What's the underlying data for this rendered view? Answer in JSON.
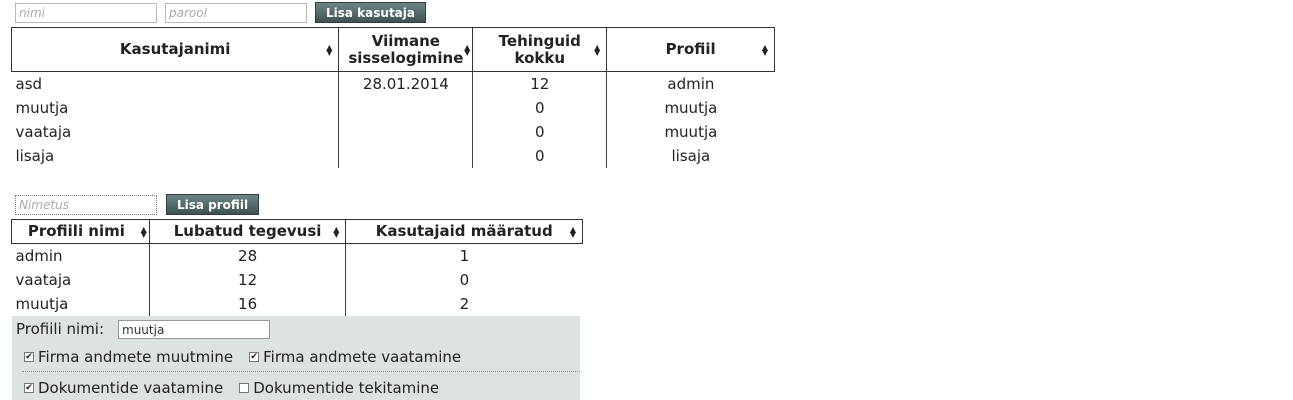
{
  "user_form": {
    "username_placeholder": "nimi",
    "password_placeholder": "parool",
    "add_button": "Lisa kasutaja"
  },
  "users_table": {
    "headers": {
      "username": "Kasutajanimi",
      "last_login_line1": "Viimane",
      "last_login_line2": "sisselogimine",
      "transactions_line1": "Tehinguid",
      "transactions_line2": "kokku",
      "profile": "Profiil"
    },
    "rows": [
      {
        "username": "asd",
        "last_login": "28.01.2014",
        "transactions": "12",
        "profile": "admin"
      },
      {
        "username": "muutja",
        "last_login": "",
        "transactions": "0",
        "profile": "muutja"
      },
      {
        "username": "vaataja",
        "last_login": "",
        "transactions": "0",
        "profile": "muutja"
      },
      {
        "username": "lisaja",
        "last_login": "",
        "transactions": "0",
        "profile": "lisaja"
      }
    ]
  },
  "profile_form": {
    "name_placeholder": "Nimetus",
    "add_button": "Lisa profiil"
  },
  "profiles_table": {
    "headers": {
      "name": "Profiili nimi",
      "allowed_actions": "Lubatud tegevusi",
      "users_assigned": "Kasutajaid määratud"
    },
    "rows": [
      {
        "name": "admin",
        "allowed_actions": "28",
        "users_assigned": "1"
      },
      {
        "name": "vaataja",
        "allowed_actions": "12",
        "users_assigned": "0"
      },
      {
        "name": "muutja",
        "allowed_actions": "16",
        "users_assigned": "2"
      }
    ]
  },
  "profile_editor": {
    "name_label": "Profiili nimi:",
    "name_value": "muutja",
    "permissions": [
      {
        "label": "Firma andmete muutmine",
        "checked": true
      },
      {
        "label": "Firma andmete vaatamine",
        "checked": true
      },
      {
        "label": "Dokumentide vaatamine",
        "checked": true
      },
      {
        "label": "Dokumentide tekitamine",
        "checked": false
      }
    ]
  }
}
